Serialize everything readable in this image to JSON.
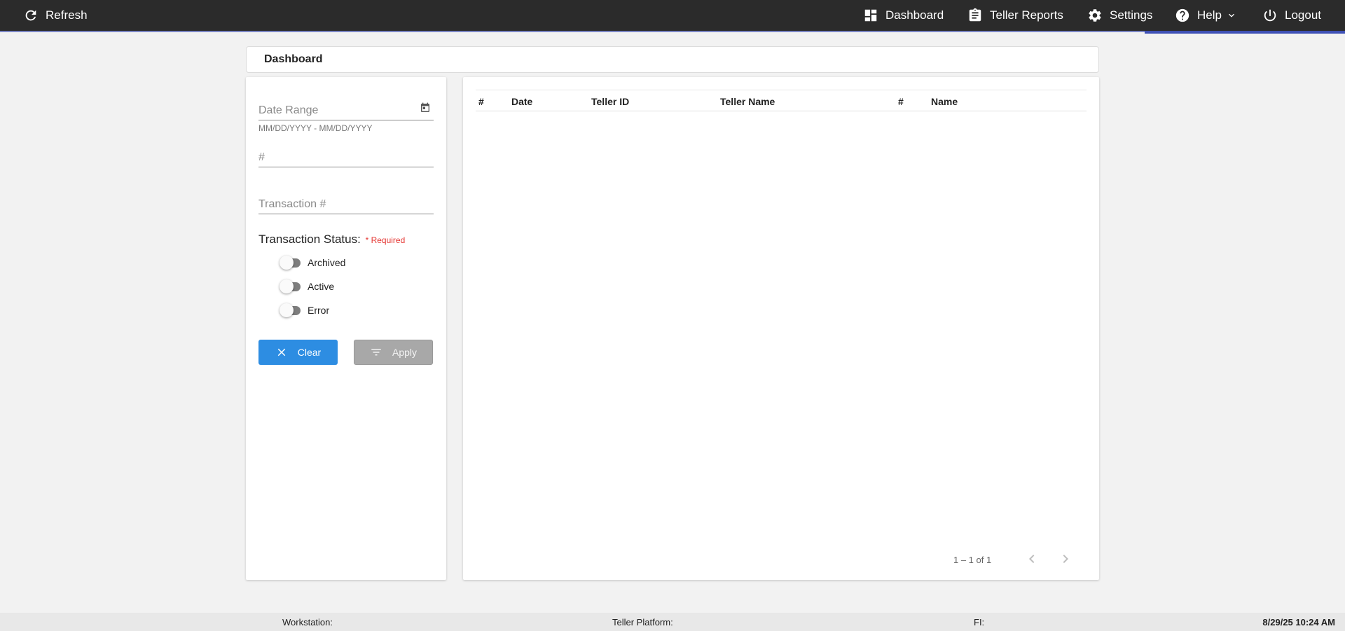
{
  "topbar": {
    "refresh_label": "Refresh",
    "nav": {
      "dashboard": "Dashboard",
      "teller_reports": "Teller Reports",
      "settings": "Settings",
      "help": "Help",
      "logout": "Logout"
    }
  },
  "page": {
    "title": "Dashboard"
  },
  "filters": {
    "date_range_placeholder": "Date Range",
    "date_range_hint": "MM/DD/YYYY - MM/DD/YYYY",
    "number_placeholder": "#",
    "transaction_placeholder": "Transaction #",
    "status_label": "Transaction Status:",
    "required_label": "* Required",
    "statuses": [
      "Archived",
      "Active",
      "Error"
    ],
    "clear_label": "Clear",
    "apply_label": "Apply"
  },
  "table": {
    "columns": [
      "#",
      "Date",
      "Teller ID",
      "Teller Name",
      "#",
      "Name"
    ],
    "rows": [],
    "pagination": "1 – 1 of 1"
  },
  "footer": {
    "workstation": "Workstation:",
    "teller_platform": "Teller Platform:",
    "fi": "FI:",
    "timestamp": "8/29/25 10:24 AM"
  },
  "colors": {
    "topbar": "#2b2b2b",
    "accent": "#3f51b5",
    "clear_button": "#2d8de2",
    "apply_button": "#a8a8a8",
    "required": "#e53935"
  }
}
